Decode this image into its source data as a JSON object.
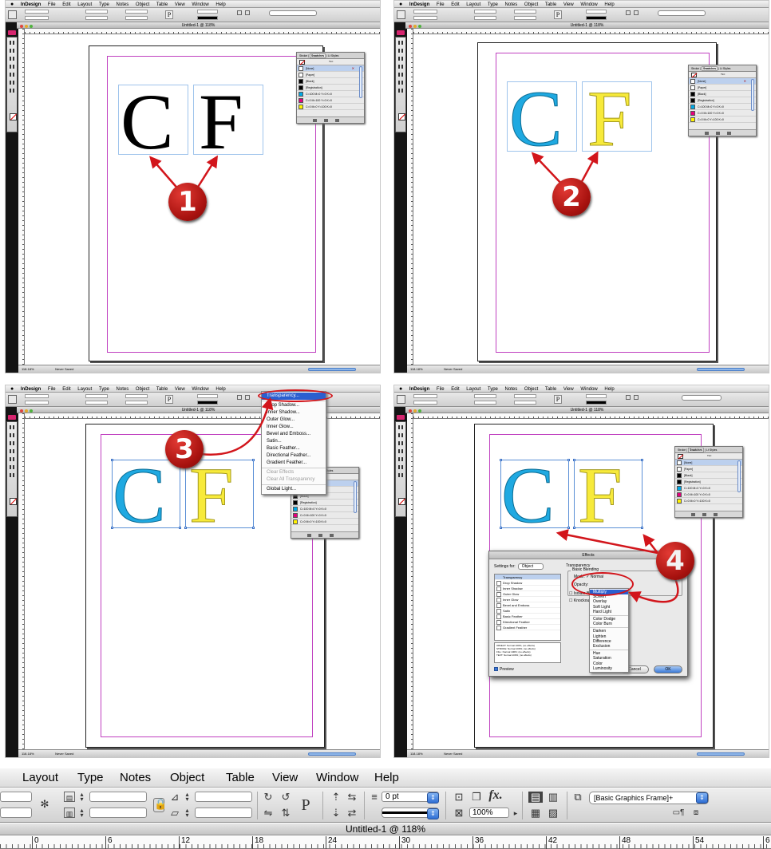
{
  "menu": {
    "apple": "",
    "app": "InDesign",
    "items": [
      "File",
      "Edit",
      "Layout",
      "Type",
      "Notes",
      "Object",
      "Table",
      "View",
      "Window",
      "Help"
    ]
  },
  "doc_title": "Untitled-1 @ 118%",
  "status": {
    "zoom": "118.18%",
    "state": "Never Saved"
  },
  "swatch_panel": {
    "tabs": [
      "Stroke",
      "Swatches",
      "Lt Styles"
    ],
    "tint": "Tint:",
    "items": [
      {
        "name": "[None]",
        "color": "#ffffff"
      },
      {
        "name": "[Paper]",
        "color": "#ffffff"
      },
      {
        "name": "[Black]",
        "color": "#000000"
      },
      {
        "name": "[Registration]",
        "color": "#000000"
      },
      {
        "name": "C=100 M=0 Y=0 K=0",
        "color": "#00a9e6"
      },
      {
        "name": "C=0 M=100 Y=0 K=0",
        "color": "#e4007c"
      },
      {
        "name": "C=0 M=0 Y=100 K=0",
        "color": "#fff200"
      }
    ]
  },
  "letters": {
    "c": "C",
    "f": "F"
  },
  "colors": {
    "black": "#000000",
    "cyan": "#1fa9e1",
    "yellow": "#f7ea3a",
    "accent": "#d2151b"
  },
  "markers": [
    "1",
    "2",
    "3",
    "4"
  ],
  "fx_menu": {
    "items": [
      "Transparency...",
      "Drop Shadow...",
      "Inner Shadow...",
      "Outer Glow...",
      "Inner Glow...",
      "Bevel and Emboss...",
      "Satin...",
      "Basic Feather...",
      "Directional Feather...",
      "Gradient Feather..."
    ],
    "disabled": [
      "Clear Effects",
      "Clear All Transparency"
    ],
    "last": "Global Light..."
  },
  "effects_dialog": {
    "title": "Effects",
    "settings_for_label": "Settings for:",
    "settings_for_value": "Object",
    "section": "Transparency",
    "group": "Basic Blending",
    "mode_label": "Mode:",
    "mode_value": "Normal",
    "opacity_label": "Opacity:",
    "isolate": "Isolate Blending",
    "knockout": "Knockout Group",
    "list": [
      "Transparency",
      "Drop Shadow",
      "Inner Shadow",
      "Outer Glow",
      "Inner Glow",
      "Bevel and Emboss",
      "Satin",
      "Basic Feather",
      "Directional Feather",
      "Gradient Feather"
    ],
    "summary": "OBJECT: Normal 100%; (no effects)\nSTROKE: Normal 100%; (no effects)\nFILL: Normal 100%; (no effects)\nTEXT: Normal 100%; (no effects)",
    "preview": "Preview",
    "cancel": "Cancel",
    "ok": "OK",
    "modes": [
      "Normal",
      "Multiply",
      "Screen",
      "Overlay",
      "Soft Light",
      "Hard Light",
      "Color Dodge",
      "Color Burn",
      "Darken",
      "Lighten",
      "Difference",
      "Exclusion",
      "Hue",
      "Saturation",
      "Color",
      "Luminosity"
    ]
  },
  "zoom_strip": {
    "menu": [
      "Layout",
      "Type",
      "Notes",
      "Object",
      "Table",
      "View",
      "Window",
      "Help"
    ],
    "stroke_weight": "0 pt",
    "zoom": "100%",
    "frame_style": "[Basic Graphics Frame]+",
    "title": "Untitled-1 @ 118%",
    "ruler": [
      "0",
      "6",
      "12",
      "18",
      "24",
      "30",
      "36",
      "42",
      "48",
      "54",
      "6"
    ]
  }
}
